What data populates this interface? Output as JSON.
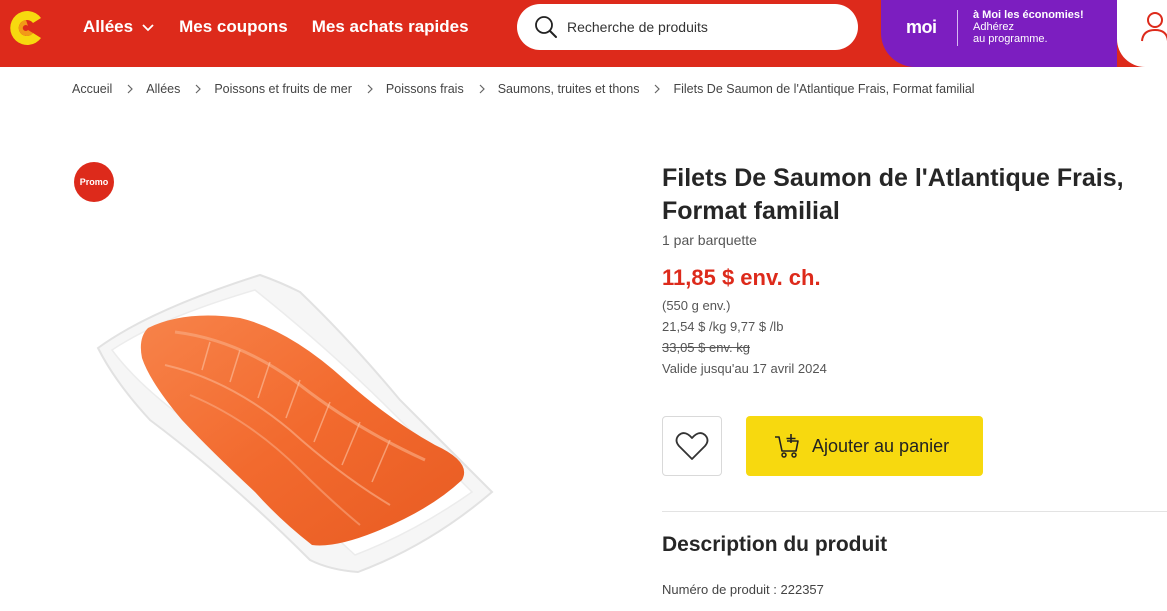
{
  "header": {
    "nav": {
      "allees": "Allées",
      "coupons": "Mes coupons",
      "quick": "Mes achats rapides"
    },
    "search": {
      "placeholder": "Recherche de produits"
    },
    "moi": {
      "logo": "moi",
      "line1": "à Moi les économies!",
      "line2": "Adhérez",
      "line3": "au programme."
    },
    "colors": {
      "brand_red": "#dd2a1b",
      "moi_purple": "#7c1ec0",
      "cta_yellow": "#f7d90f",
      "logo_yellow": "#f7d90f"
    }
  },
  "breadcrumb": [
    "Accueil",
    "Allées",
    "Poissons et fruits de mer",
    "Poissons frais",
    "Saumons, truites et thons",
    "Filets De Saumon de l'Atlantique Frais, Format familial"
  ],
  "product": {
    "promo_badge": "Promo",
    "title_line1": "Filets De Saumon de l'Atlantique Frais,",
    "title_line2": "Format familial",
    "unit": "1 par barquette",
    "price": "11,85 $ env. ch.",
    "weight": "(550 g env.)",
    "unit_prices": "21,54 $ /kg 9,77 $ /lb",
    "old_price": "33,05 $  env. kg",
    "valid_until": "Valide jusqu'au 17 avril 2024",
    "add_to_cart": "Ajouter au panier",
    "description_title": "Description du produit",
    "product_number": "Numéro de produit : 222357"
  },
  "icons": {
    "logo": "store-logo-icon",
    "chevron": "chevron-down-icon",
    "search": "search-icon",
    "user": "user-icon",
    "breadcrumb_sep": "chevron-right-icon",
    "favorite": "heart-icon",
    "cart": "cart-add-icon"
  }
}
